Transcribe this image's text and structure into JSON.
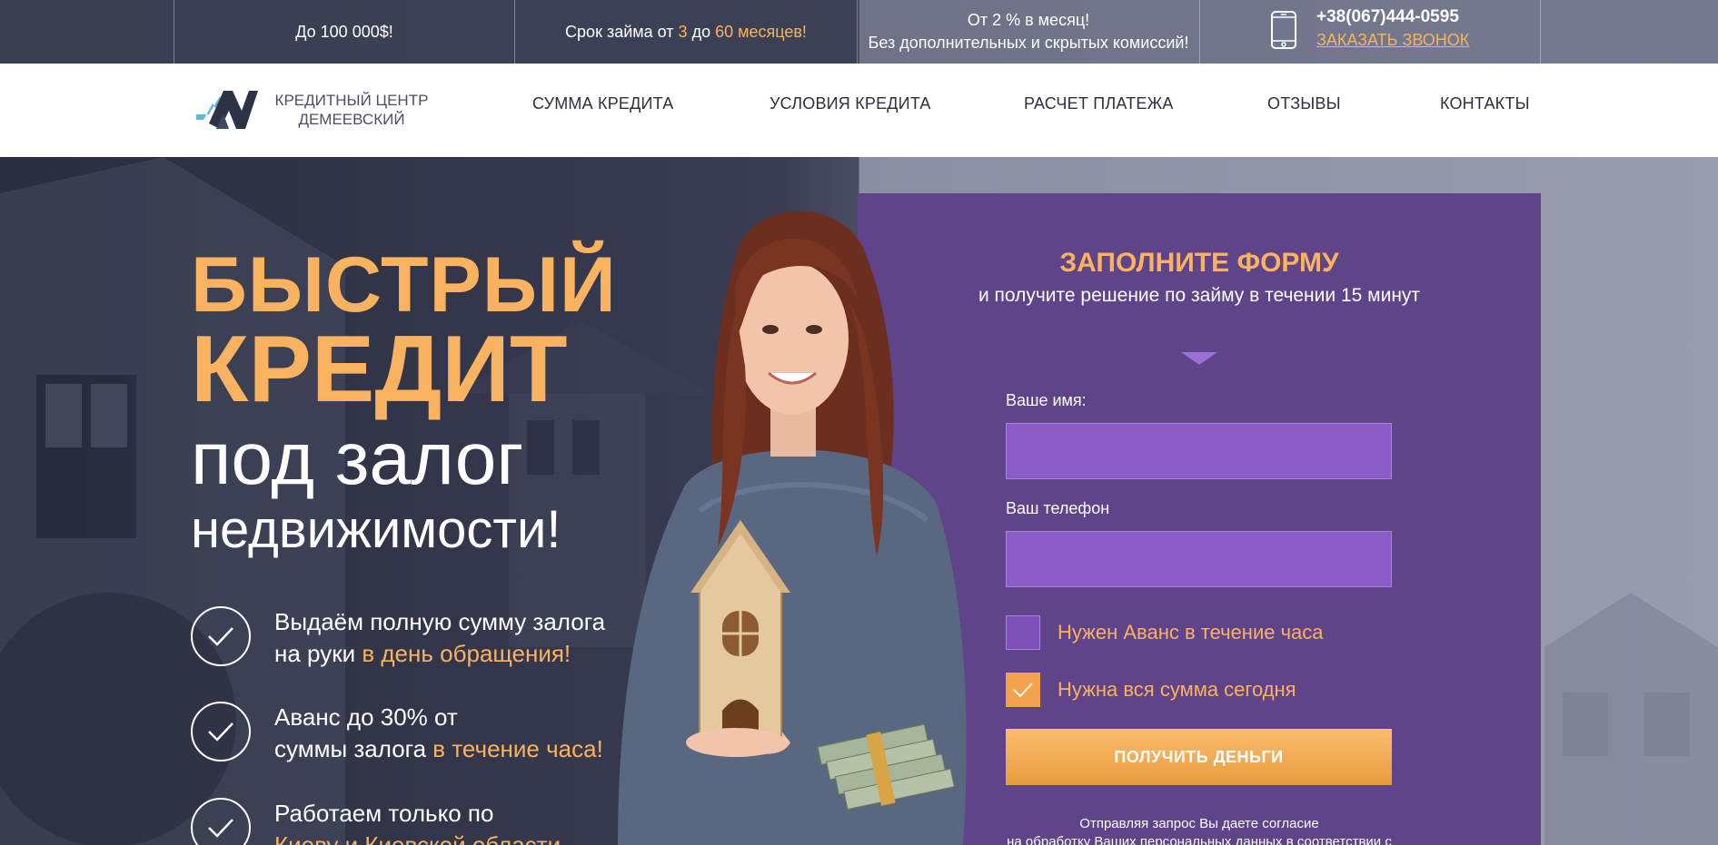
{
  "topbar": {
    "cell1": "До 100 000$!",
    "cell2_prefix": "Срок займа от",
    "cell2_num1": "3",
    "cell2_mid": "до",
    "cell2_num2": "60 месяцев!",
    "cell3_line1": "От 2 % в месяц!",
    "cell3_line2": "Без дополнительных и скрытых комиссий!",
    "phone": "+38(067)444-0595",
    "call_link": "ЗАКАЗАТЬ ЗВОНОК"
  },
  "logo": {
    "line1": "КРЕДИТНЫЙ ЦЕНТР",
    "line2": "ДЕМЕЕВСКИЙ"
  },
  "nav": {
    "items": [
      "СУММА КРЕДИТА",
      "УСЛОВИЯ КРЕДИТА",
      "РАСЧЕТ ПЛАТЕЖА",
      "ОТЗЫВЫ",
      "КОНТАКТЫ"
    ]
  },
  "hero": {
    "title1": "БЫСТРЫЙ",
    "title2": "КРЕДИТ",
    "title3": "под залог",
    "title4": "недвижимости!",
    "features": [
      {
        "line1": "Выдаём полную сумму залога",
        "line2_plain": "на руки",
        "line2_accent": "в день обращения!"
      },
      {
        "line1": "Аванс до 30% от",
        "line2_plain": "суммы залога",
        "line2_accent": "в течение часа!"
      },
      {
        "line1": "Работаем только по",
        "line2_plain": "",
        "line2_accent": "Киеву и Киевской области"
      }
    ]
  },
  "form": {
    "title": "ЗАПОЛНИТЕ ФОРМУ",
    "subtitle": "и получите решение по займу в течении 15 минут",
    "name_label": "Ваше имя:",
    "phone_label": "Ваш телефон",
    "name_value": "",
    "phone_value": "",
    "checkbox1_label": "Нужен Аванс в течение часа",
    "checkbox1_checked": false,
    "checkbox2_label": "Нужна вся сумма сегодня",
    "checkbox2_checked": true,
    "submit_label": "ПОЛУЧИТЬ ДЕНЬГИ",
    "note_line1": "Отправляя запрос Вы даете согласие",
    "note_line2": "на обработку Ваших персональных данных в соответствии с"
  },
  "colors": {
    "accent": "#f9b25f",
    "form_bg": "#5f4489",
    "input_bg": "#8b5bc8"
  }
}
